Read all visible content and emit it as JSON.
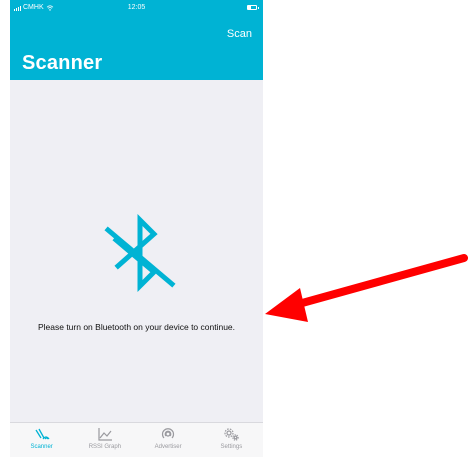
{
  "status_bar": {
    "carrier": "CMHK",
    "time": "12:05"
  },
  "header": {
    "scan_label": "Scan",
    "title": "Scanner"
  },
  "main": {
    "message": "Please turn on Bluetooth on your device to continue.",
    "icon": "bluetooth-off-icon"
  },
  "tabbar": {
    "tabs": [
      {
        "label": "Scanner",
        "icon": "scanner-signal-icon",
        "active": true
      },
      {
        "label": "RSSI Graph",
        "icon": "line-graph-icon",
        "active": false
      },
      {
        "label": "Advertiser",
        "icon": "advertiser-icon",
        "active": false
      },
      {
        "label": "Settings",
        "icon": "gear-icon",
        "active": false
      }
    ]
  },
  "colors": {
    "accent": "#00b3d4",
    "background": "#efeff4",
    "annotation_arrow": "#ff0000"
  }
}
